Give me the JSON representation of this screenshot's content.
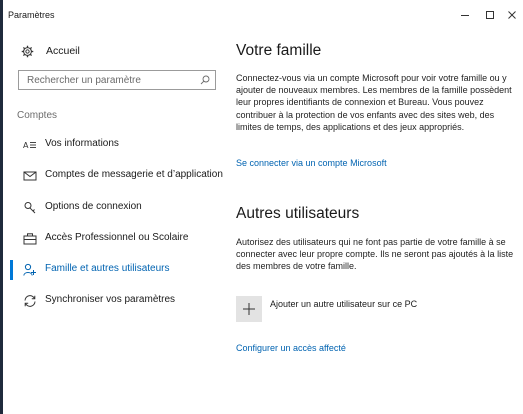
{
  "window": {
    "title": "Paramètres",
    "controls": {
      "minimize": "minimize",
      "maximize": "maximize",
      "close": "close"
    }
  },
  "sidebar": {
    "home_label": "Accueil",
    "search_placeholder": "Rechercher un paramètre",
    "section_label": "Comptes",
    "items": [
      {
        "label": "Vos informations",
        "icon": "contact-card-icon",
        "active": false
      },
      {
        "label": "Comptes de messagerie et d’application",
        "icon": "mail-icon",
        "active": false
      },
      {
        "label": "Options de connexion",
        "icon": "key-icon",
        "active": false
      },
      {
        "label": "Accès Professionnel ou Scolaire",
        "icon": "briefcase-icon",
        "active": false
      },
      {
        "label": "Famille et autres utilisateurs",
        "icon": "people-icon",
        "active": true
      },
      {
        "label": "Synchroniser vos paramètres",
        "icon": "sync-icon",
        "active": false
      }
    ]
  },
  "main": {
    "family": {
      "title": "Votre famille",
      "description": "Connectez-vous via un compte Microsoft pour voir votre famille ou y ajouter de nouveaux membres. Les membres de la famille possèdent leur propres identifiants de connexion et Bureau. Vous pouvez contribuer à la protection de vos enfants avec des sites web, des limites de temps, des applications et des jeux appropriés.",
      "link": "Se connecter via un compte Microsoft"
    },
    "other_users": {
      "title": "Autres utilisateurs",
      "description": "Autorisez des utilisateurs qui ne font pas partie de votre famille à se connecter avec leur propre compte. Ils ne seront pas ajoutés à la liste des membres de votre famille.",
      "add_user_label": "Ajouter un autre utilisateur sur ce PC",
      "assigned_access_link": "Configurer un accès affecté"
    }
  },
  "colors": {
    "accent": "#0078d7",
    "link": "#0063b1",
    "add_tile": "#e3e3e3",
    "window_edge": "#1f2a3c"
  }
}
